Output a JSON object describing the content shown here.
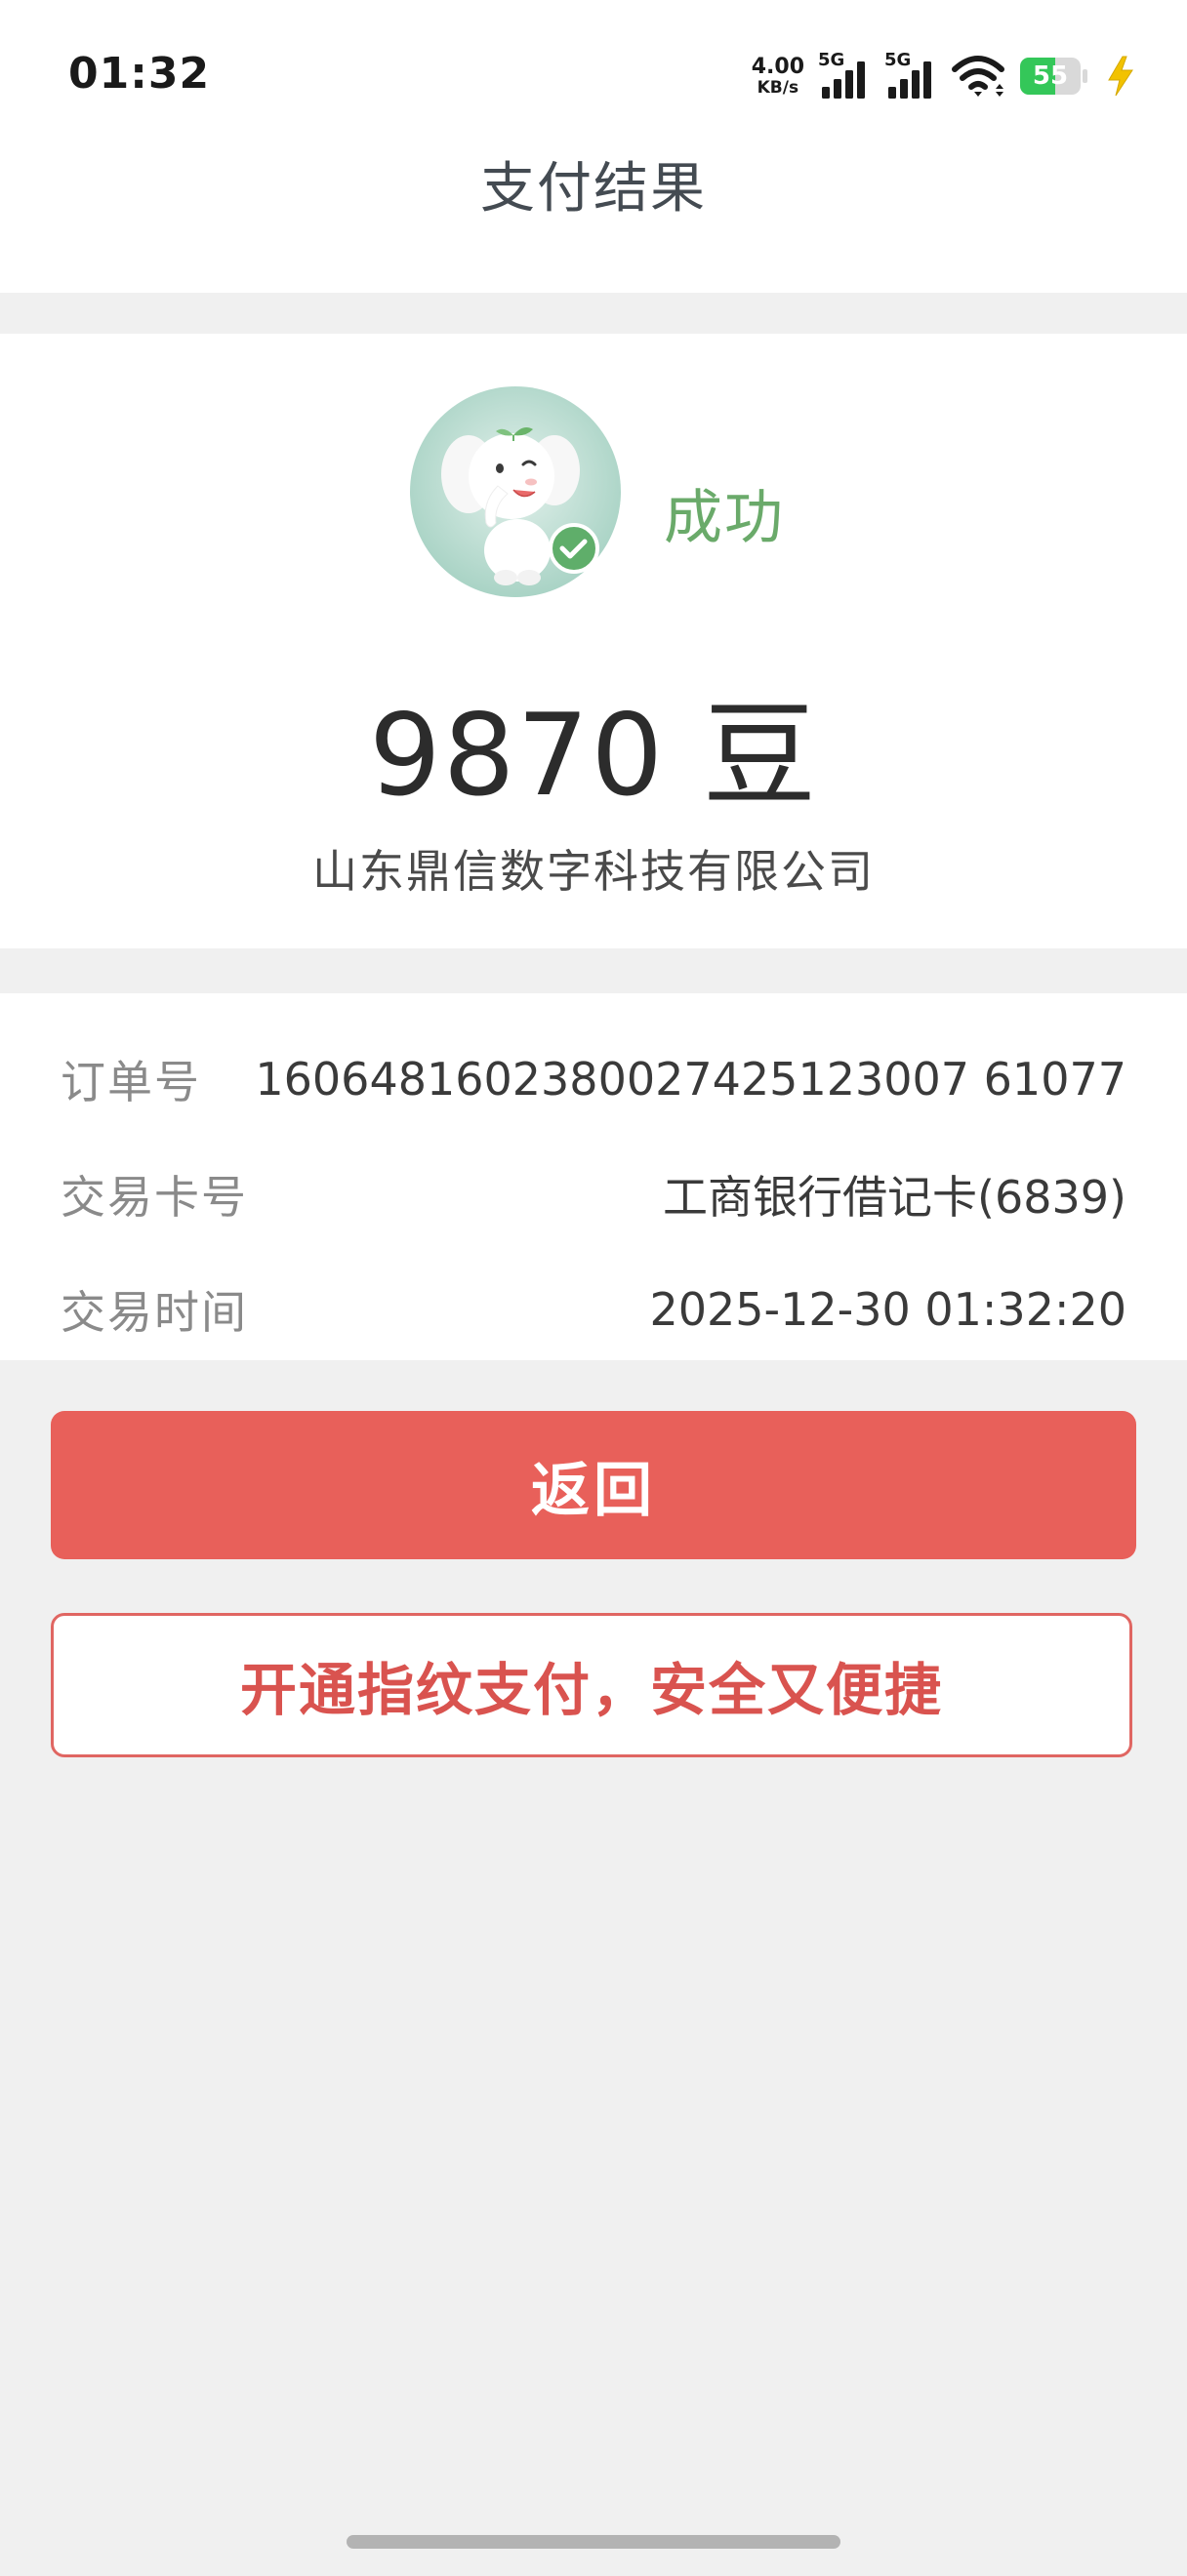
{
  "status_bar": {
    "time": "01:32",
    "net_speed_value": "4.00",
    "net_speed_unit": "KB/s",
    "sim1_label": "5G",
    "sim2_label": "5G",
    "battery_level": "55",
    "icons": [
      "signal-icon",
      "signal-icon",
      "wifi-icon",
      "battery-icon",
      "charging-bolt-icon"
    ]
  },
  "header": {
    "title": "支付结果"
  },
  "result": {
    "status": "成功",
    "amount": "9870 豆",
    "merchant": "山东鼎信数字科技有限公司",
    "mascot_icon": "elephant-mascot-success-icon"
  },
  "details": [
    {
      "label": "订单号",
      "value": "1606481602380027425123007 61077"
    },
    {
      "label": "交易卡号",
      "value": "工商银行借记卡(6839)"
    },
    {
      "label": "交易时间",
      "value": "2025-12-30 01:32:20"
    }
  ],
  "actions": {
    "return_label": "返回",
    "fingerprint_label": "开通指纹支付，安全又便捷"
  },
  "colors": {
    "success_green": "#6aaa6a",
    "primary_red": "#e8605a",
    "outline_red": "#e06662",
    "battery_green": "#34c759"
  }
}
